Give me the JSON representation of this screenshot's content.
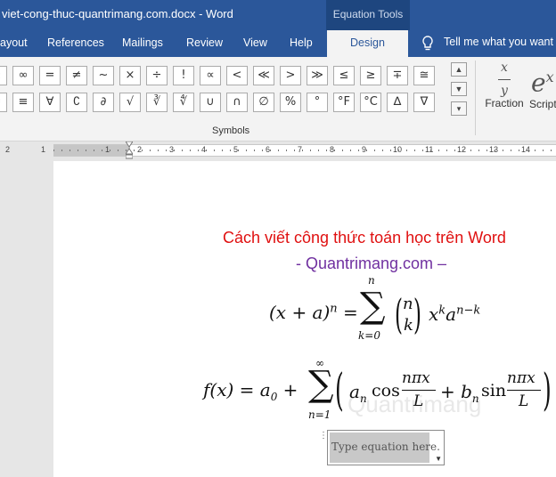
{
  "titlebar": {
    "title": "viet-cong-thuc-quantrimang.com.docx  -  Word",
    "contextual_tab": "Equation Tools"
  },
  "tabs": [
    {
      "label": "ayout"
    },
    {
      "label": "References"
    },
    {
      "label": "Mailings"
    },
    {
      "label": "Review"
    },
    {
      "label": "View"
    },
    {
      "label": "Help"
    },
    {
      "label": "Design"
    }
  ],
  "tellme": {
    "label": "Tell me what you want t"
  },
  "symbols": {
    "row1": [
      "±",
      "∞",
      "=",
      "≠",
      "~",
      "×",
      "÷",
      "!",
      "∝",
      "<",
      "≪",
      ">",
      "≫",
      "≤",
      "≥",
      "∓",
      "≅"
    ],
    "row2": [
      "≈",
      "≡",
      "∀",
      "∁",
      "∂",
      "√",
      "∛",
      "∜",
      "∪",
      "∩",
      "∅",
      "%",
      "°",
      "°F",
      "°C",
      "∆",
      "∇"
    ],
    "group_label": "Symbols"
  },
  "fraction": {
    "numerator": "x",
    "denominator": "y",
    "label": "Fraction"
  },
  "script": {
    "base": "e",
    "superscript": "x",
    "label": "Script"
  },
  "ruler": {
    "numbers": [
      "2",
      "1",
      "1",
      "2",
      "3",
      "4",
      "5",
      "6",
      "7",
      "8",
      "9",
      "10",
      "11",
      "12",
      "13",
      "14"
    ]
  },
  "document": {
    "heading": "Cách viết công thức toán học trên Word",
    "subheading": "- Quantrimang.com –",
    "equation_placeholder": "Type equation here.",
    "watermark": "Quantrimang"
  }
}
